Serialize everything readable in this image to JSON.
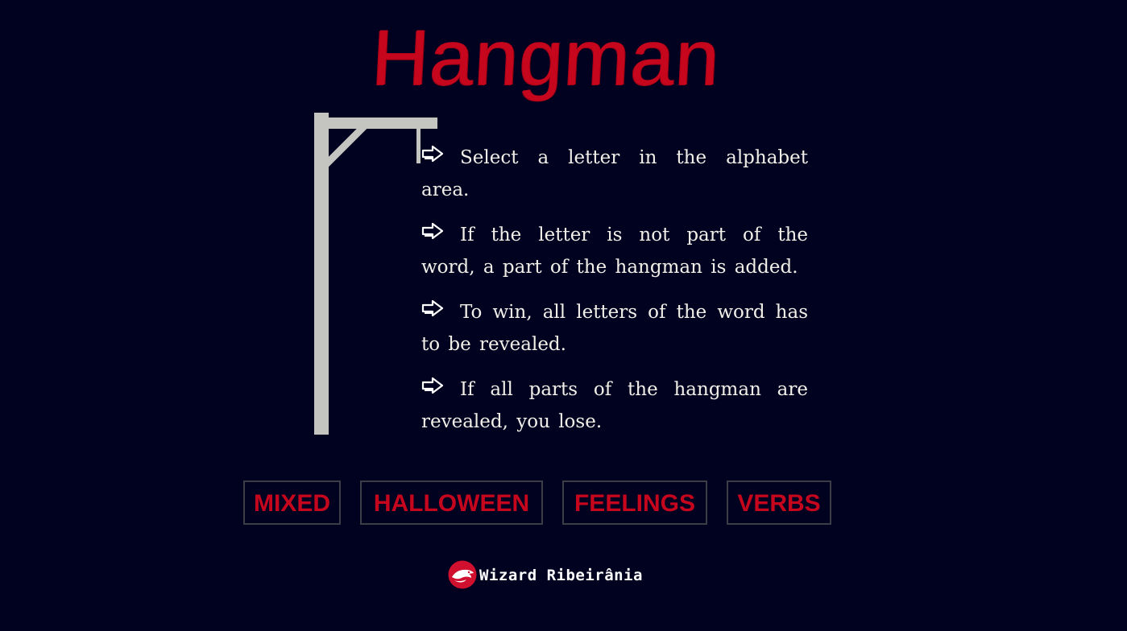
{
  "title": "Hangman",
  "instructions": [
    "Select a letter in the alphabet area.",
    "If the letter is not part of the word, a part of the hangman is added.",
    "To win, all letters of the word has to be revealed.",
    "If all parts of the hangman are revealed, you lose."
  ],
  "instruction_icon": "arrow-right-outline-icon",
  "categories": [
    "MIXED",
    "HALLOWEEN",
    "FEELINGS",
    "VERBS"
  ],
  "brand": "Wizard Ribeirânia",
  "colors": {
    "background": "#000220",
    "accent": "#c5061d",
    "gallows": "#c4c4c0",
    "text": "#f1efe8"
  }
}
